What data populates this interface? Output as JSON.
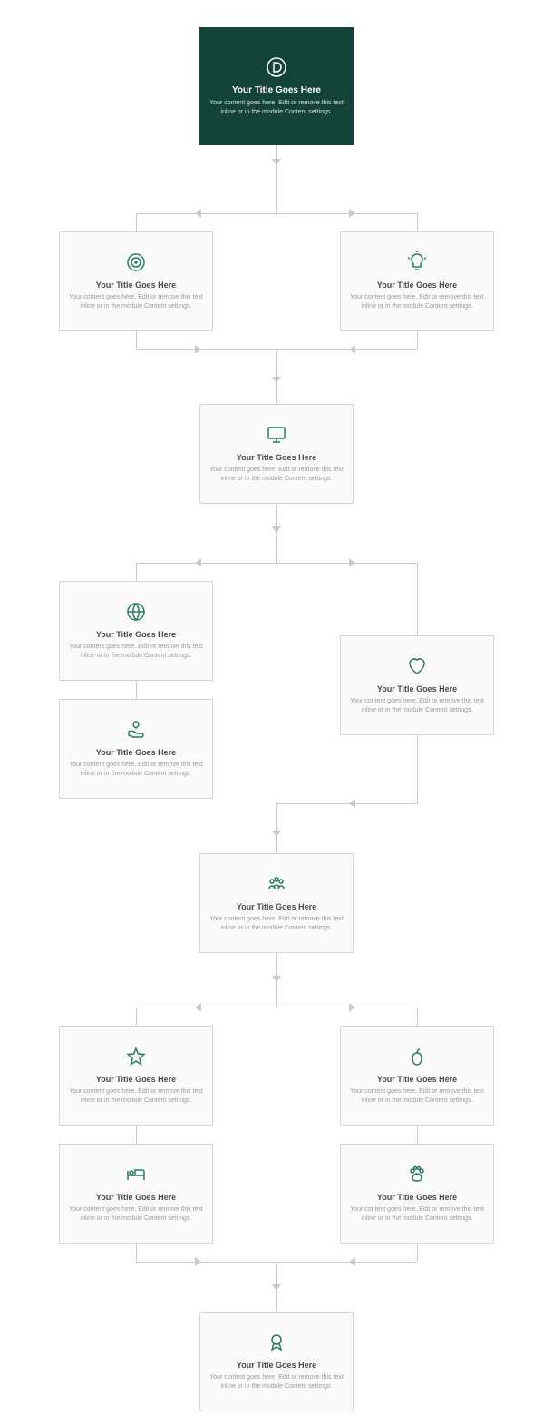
{
  "colors": {
    "accent": "#134339",
    "icon": "#2a7a63",
    "border": "#d5d5d5",
    "muted": "#9a9a9a",
    "arrow": "#cacaca"
  },
  "default_title": "Your Title Goes Here",
  "default_content": "Your content goes here. Edit or remove this text inline or in the module Content settings.",
  "nodes": {
    "hero": {
      "icon": "divi-logo",
      "title": "Your Title Goes Here",
      "content": "Your content goes here. Edit or remove this text inline or in the module Content settings."
    },
    "n2a": {
      "icon": "target",
      "title": "Your Title Goes Here",
      "content": "Your content goes here. Edit or remove this text inline or in the module Content settings."
    },
    "n2b": {
      "icon": "lightbulb",
      "title": "Your Title Goes Here",
      "content": "Your content goes here. Edit or remove this text inline or in the module Content settings."
    },
    "n3": {
      "icon": "monitor",
      "title": "Your Title Goes Here",
      "content": "Your content goes here. Edit or remove this text inline or in the module Content settings."
    },
    "n4a": {
      "icon": "globe",
      "title": "Your Title Goes Here",
      "content": "Your content goes here. Edit or remove this text inline or in the module Content settings."
    },
    "n4a2": {
      "icon": "hand-heart",
      "title": "Your Title Goes Here",
      "content": "Your content goes here. Edit or remove this text inline or in the module Content settings."
    },
    "n4b": {
      "icon": "heart",
      "title": "Your Title Goes Here",
      "content": "Your content goes here. Edit or remove this text inline or in the module Content settings."
    },
    "n5": {
      "icon": "people",
      "title": "Your Title Goes Here",
      "content": "Your content goes here. Edit or remove this text inline or in the module Content settings."
    },
    "n6a": {
      "icon": "star",
      "title": "Your Title Goes Here",
      "content": "Your content goes here. Edit or remove this text inline or in the module Content settings."
    },
    "n6b": {
      "icon": "apple",
      "title": "Your Title Goes Here",
      "content": "Your content goes here. Edit or remove this text inline or in the module Content settings."
    },
    "n6a2": {
      "icon": "bed",
      "title": "Your Title Goes Here",
      "content": "Your content goes here. Edit or remove this text inline or in the module Content settings."
    },
    "n6b2": {
      "icon": "paw",
      "title": "Your Title Goes Here",
      "content": "Your content goes here. Edit or remove this text inline or in the module Content settings."
    },
    "n7": {
      "icon": "ribbon",
      "title": "Your Title Goes Here",
      "content": "Your content goes here. Edit or remove this text inline or in the module Content settings."
    }
  }
}
